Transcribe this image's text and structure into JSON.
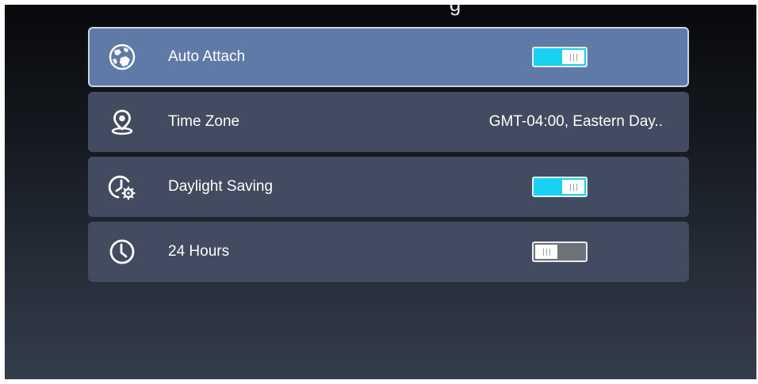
{
  "header": {
    "title_fragment": "g"
  },
  "settings": [
    {
      "label": "Auto Attach",
      "icon": "globe-icon",
      "control": "toggle",
      "state": "on",
      "selected": true
    },
    {
      "label": "Time Zone",
      "icon": "location-pin-icon",
      "control": "value",
      "value": "GMT-04:00, Eastern Day.."
    },
    {
      "label": "Daylight Saving",
      "icon": "clock-gear-icon",
      "control": "toggle",
      "state": "on"
    },
    {
      "label": "24 Hours",
      "icon": "clock-icon",
      "control": "toggle",
      "state": "off"
    }
  ],
  "colors": {
    "selected_row": "#5f7aa6",
    "row": "#434b60",
    "toggle_on": "#19d2f2",
    "toggle_off": "#6e7279"
  }
}
